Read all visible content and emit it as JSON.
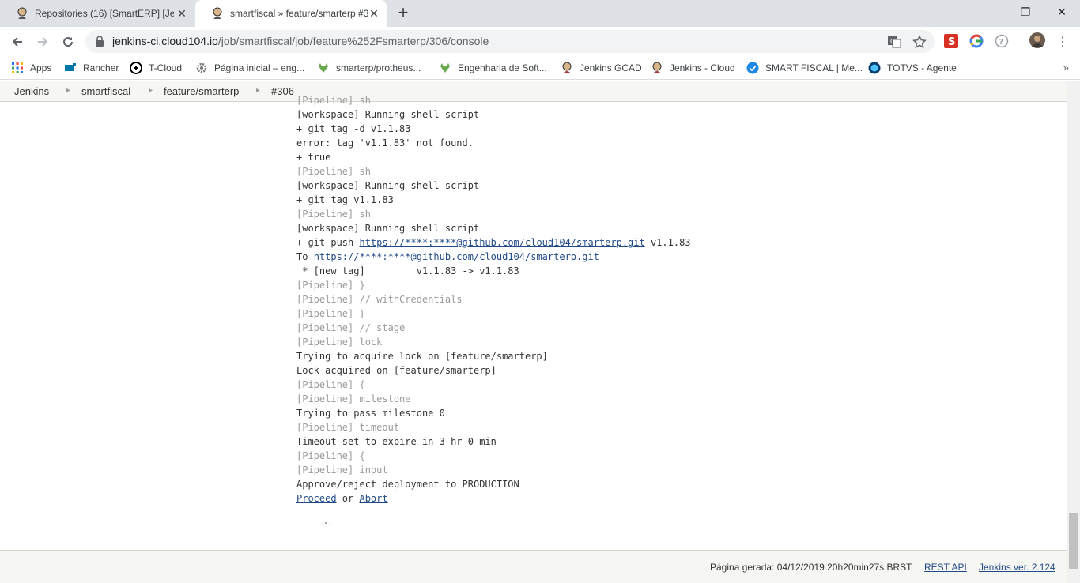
{
  "browser": {
    "tabs": [
      {
        "title": "Repositories (16) [SmartERP] [Jen",
        "active": false
      },
      {
        "title": "smartfiscal » feature/smarterp #3",
        "active": true
      }
    ],
    "new_tab": "+",
    "window_controls": {
      "minimize": "–",
      "maximize": "❐",
      "close": "✕"
    },
    "url_host": "jenkins-ci.cloud104.io",
    "url_path": "/job/smartfiscal/job/feature%252Fsmarterp/306/console"
  },
  "bookmarks": [
    {
      "label": "Apps",
      "icon": "apps-grid-icon"
    },
    {
      "label": "Rancher",
      "icon": "rancher-icon"
    },
    {
      "label": "T-Cloud",
      "icon": "tcloud-icon"
    },
    {
      "label": "Página inicial – eng...",
      "icon": "gear-icon"
    },
    {
      "label": "smarterp/protheus...",
      "icon": "gitlab-icon"
    },
    {
      "label": "Engenharia de Soft...",
      "icon": "gitlab-icon"
    },
    {
      "label": "Jenkins GCAD",
      "icon": "jenkins-icon"
    },
    {
      "label": "Jenkins - Cloud",
      "icon": "jenkins-icon"
    },
    {
      "label": "SMART FISCAL | Me...",
      "icon": "check-badge-icon"
    },
    {
      "label": "TOTVS - Agente",
      "icon": "totvs-icon"
    }
  ],
  "bookmarks_more": "»",
  "breadcrumbs": [
    "Jenkins",
    "smartfiscal",
    "feature/smarterp",
    "#306"
  ],
  "console": {
    "lines": [
      {
        "t": "[Pipeline] sh",
        "k": "pipe"
      },
      {
        "t": "[workspace] Running shell script",
        "k": "out"
      },
      {
        "t": "+ git tag -d v1.1.83",
        "k": "out"
      },
      {
        "t": "error: tag 'v1.1.83' not found.",
        "k": "out"
      },
      {
        "t": "+ true",
        "k": "out"
      },
      {
        "t": "[Pipeline] sh",
        "k": "pipe"
      },
      {
        "t": "[workspace] Running shell script",
        "k": "out"
      },
      {
        "t": "+ git tag v1.1.83",
        "k": "out"
      },
      {
        "t": "[Pipeline] sh",
        "k": "pipe"
      },
      {
        "t": "[workspace] Running shell script",
        "k": "out"
      },
      {
        "pre": "+ git push ",
        "link": "https://****:****@github.com/cloud104/smarterp.git",
        "post": " v1.1.83",
        "k": "mixed"
      },
      {
        "pre": "To ",
        "link": "https://****:****@github.com/cloud104/smarterp.git",
        "post": "",
        "k": "mixed"
      },
      {
        "t": " * [new tag]         v1.1.83 -> v1.1.83",
        "k": "out"
      },
      {
        "t": "[Pipeline] }",
        "k": "pipe"
      },
      {
        "t": "[Pipeline] // withCredentials",
        "k": "pipe"
      },
      {
        "t": "[Pipeline] }",
        "k": "pipe"
      },
      {
        "t": "[Pipeline] // stage",
        "k": "pipe"
      },
      {
        "t": "[Pipeline] lock",
        "k": "pipe"
      },
      {
        "t": "Trying to acquire lock on [feature/smarterp]",
        "k": "out"
      },
      {
        "t": "Lock acquired on [feature/smarterp]",
        "k": "out"
      },
      {
        "t": "[Pipeline] {",
        "k": "pipe"
      },
      {
        "t": "[Pipeline] milestone",
        "k": "pipe"
      },
      {
        "t": "Trying to pass milestone 0",
        "k": "out"
      },
      {
        "t": "[Pipeline] timeout",
        "k": "pipe"
      },
      {
        "t": "Timeout set to expire in 3 hr 0 min",
        "k": "out"
      },
      {
        "t": "[Pipeline] {",
        "k": "pipe"
      },
      {
        "t": "[Pipeline] input",
        "k": "pipe"
      },
      {
        "t": "Approve/reject deployment to PRODUCTION",
        "k": "out"
      }
    ],
    "proceed": "Proceed",
    "or_text": " or ",
    "abort": "Abort"
  },
  "footer": {
    "generated": "Página gerada: 04/12/2019 20h20min27s BRST",
    "rest_api": "REST API",
    "version": "Jenkins ver. 2.124"
  }
}
